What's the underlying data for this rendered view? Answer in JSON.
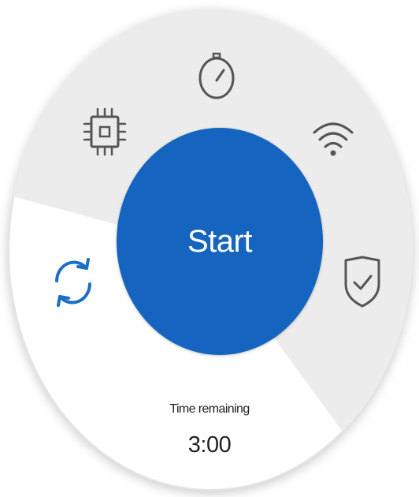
{
  "start_button": {
    "label": "Start"
  },
  "timer": {
    "label": "Time remaining",
    "value": "3:00"
  },
  "icons": [
    {
      "name": "processor-icon",
      "semantic": "cpu chip"
    },
    {
      "name": "speedometer-icon",
      "semantic": "gauge / speed"
    },
    {
      "name": "wifi-icon",
      "semantic": "wireless signal"
    },
    {
      "name": "refresh-icon",
      "semantic": "sync arrows"
    },
    {
      "name": "shield-check-icon",
      "semantic": "security shield with checkmark"
    }
  ],
  "colors": {
    "accent": "#1565c0",
    "sync_icon": "#1a6fc4",
    "icon_stroke": "#555555",
    "dial_shade": "#ececec",
    "dial_bg": "#ffffff",
    "text": "#222222"
  }
}
